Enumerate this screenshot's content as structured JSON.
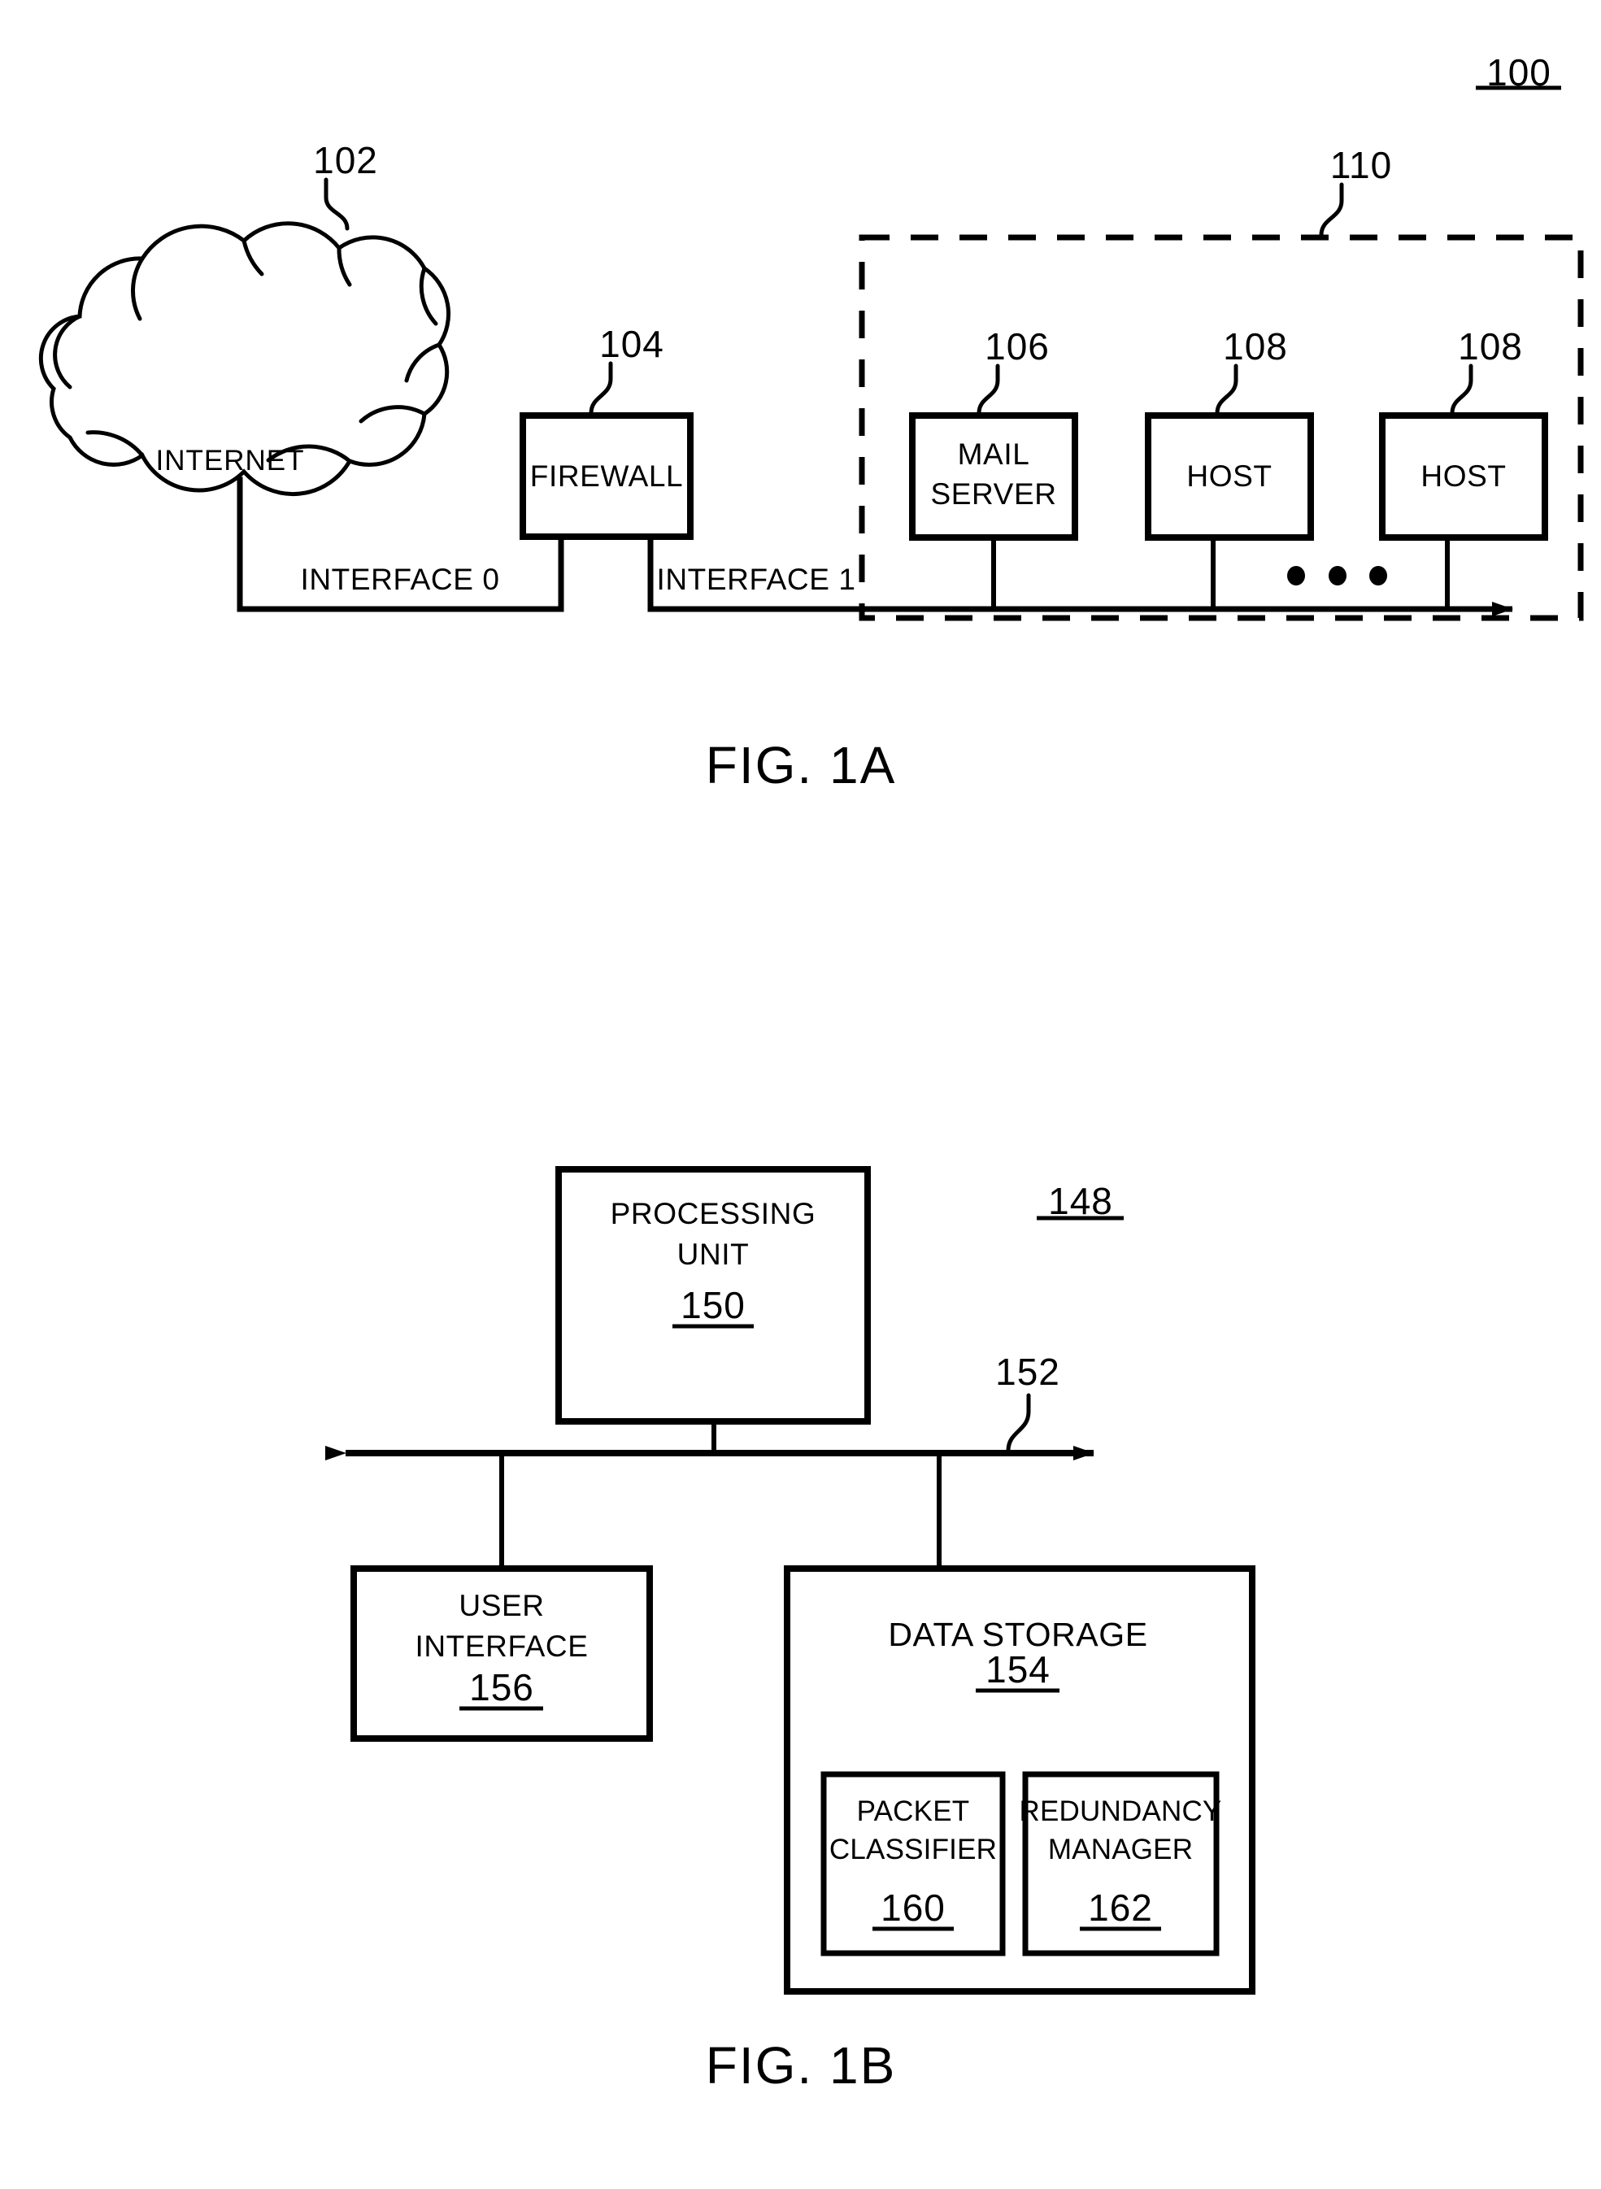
{
  "document": {
    "kind": "patent-figure-sheet",
    "background_color": "#ffffff",
    "ink_color": "#000000"
  },
  "figures": [
    {
      "id": "fig-1a",
      "caption": "FIG. 1A",
      "system_ref": "100",
      "elements": {
        "cloud": {
          "label": "INTERNET",
          "ref": "102"
        },
        "firewall": {
          "label": "FIREWALL",
          "ref": "104"
        },
        "mail_server": {
          "label_line1": "MAIL",
          "label_line2": "SERVER",
          "ref": "106"
        },
        "host_1": {
          "label": "HOST",
          "ref": "108"
        },
        "host_2": {
          "label": "HOST",
          "ref": "108"
        },
        "protected_network": {
          "ref": "110"
        },
        "interface_0": {
          "label": "INTERFACE 0"
        },
        "interface_1": {
          "label": "INTERFACE 1"
        },
        "ellipsis": "• • •"
      }
    },
    {
      "id": "fig-1b",
      "caption": "FIG. 1B",
      "system_ref": "148",
      "elements": {
        "processing_unit": {
          "label_line1": "PROCESSING",
          "label_line2": "UNIT",
          "ref": "150"
        },
        "bus": {
          "ref": "152"
        },
        "user_interface": {
          "label_line1": "USER",
          "label_line2": "INTERFACE",
          "ref": "156"
        },
        "data_storage": {
          "label": "DATA STORAGE",
          "ref": "154"
        },
        "packet_classifier": {
          "label_line1": "PACKET",
          "label_line2": "CLASSIFIER",
          "ref": "160"
        },
        "redundancy_manager": {
          "label_line1": "REDUNDANCY",
          "label_line2": "MANAGER",
          "ref": "162"
        }
      }
    }
  ]
}
